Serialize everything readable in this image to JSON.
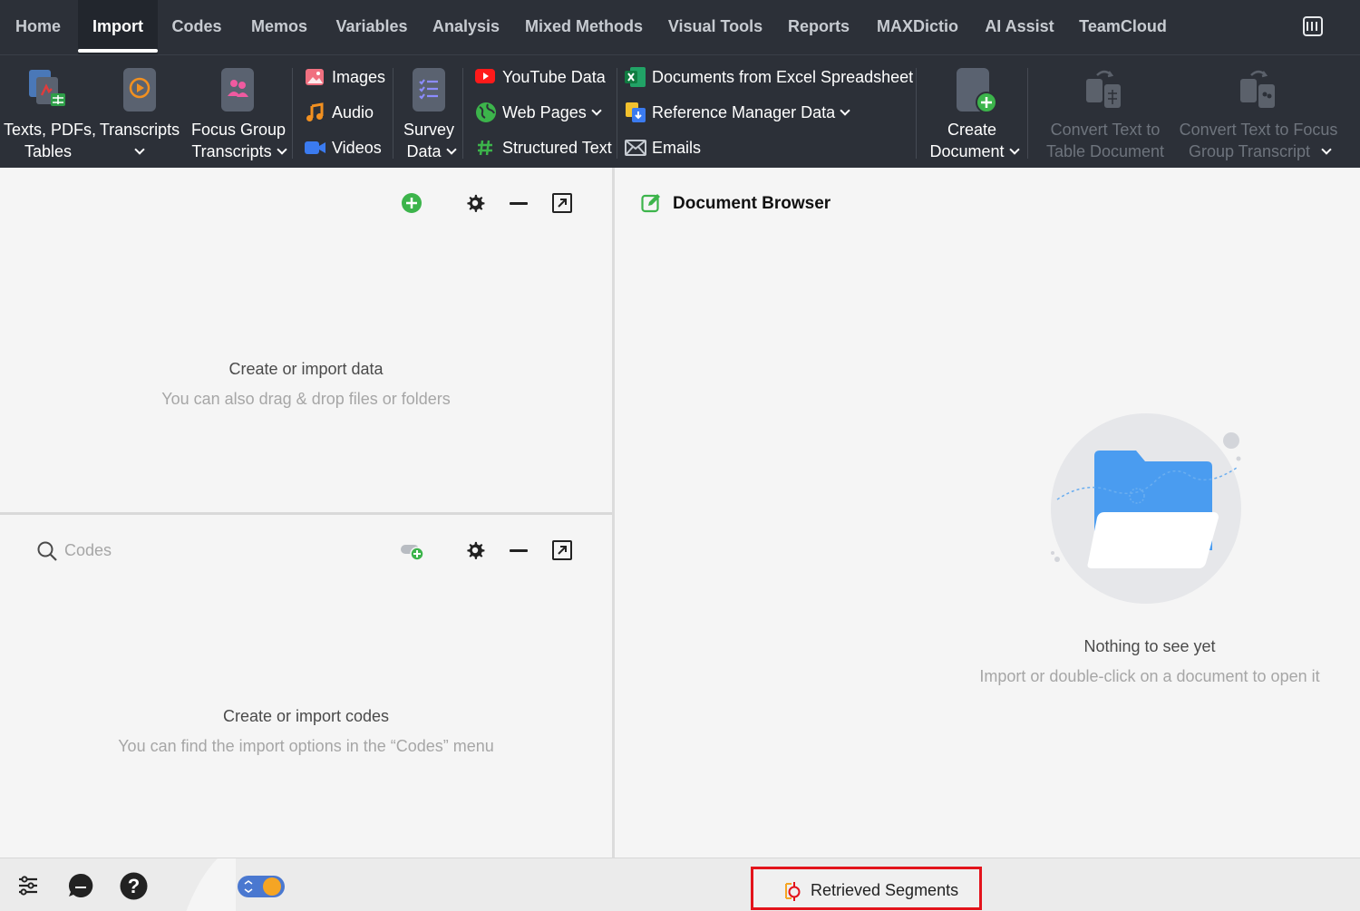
{
  "menubar": {
    "tabs": [
      {
        "label": "Home",
        "active": false
      },
      {
        "label": "Import",
        "active": true
      },
      {
        "label": "Codes",
        "active": false
      },
      {
        "label": "Memos",
        "active": false
      },
      {
        "label": "Variables",
        "active": false
      },
      {
        "label": "Analysis",
        "active": false
      },
      {
        "label": "Mixed Methods",
        "active": false
      },
      {
        "label": "Visual Tools",
        "active": false
      },
      {
        "label": "Reports",
        "active": false
      },
      {
        "label": "MAXDictio",
        "active": false
      },
      {
        "label": "AI Assist",
        "active": false
      },
      {
        "label": "TeamCloud",
        "active": false
      }
    ],
    "layout_icon": "columns-layout-icon"
  },
  "ribbon": {
    "texts": {
      "line1": "Texts, PDFs,",
      "line2": "Tables"
    },
    "transcripts": {
      "line1": "Transcripts"
    },
    "focus_group": {
      "line1": "Focus Group",
      "line2": "Transcripts"
    },
    "images": "Images",
    "audio": "Audio",
    "videos": "Videos",
    "survey": {
      "line1": "Survey",
      "line2": "Data"
    },
    "youtube": "YouTube Data",
    "web_pages": "Web Pages",
    "structured_text": "Structured Text",
    "excel_docs": "Documents from Excel Spreadsheet",
    "reference_manager": "Reference Manager Data",
    "emails": "Emails",
    "create_document": {
      "line1": "Create",
      "line2": "Document"
    },
    "convert_table": {
      "line1": "Convert Text to",
      "line2": "Table Document"
    },
    "convert_focus": {
      "line1": "Convert Text to Focus",
      "line2": "Group Transcript"
    }
  },
  "documents_pane": {
    "empty_title": "Create or import data",
    "empty_subtitle": "You can also drag & drop files or folders"
  },
  "codes_pane": {
    "search_placeholder": "Codes",
    "empty_title": "Create or import codes",
    "empty_subtitle": "You can find the import options in the “Codes” menu"
  },
  "document_browser": {
    "title": "Document Browser",
    "empty_title": "Nothing to see yet",
    "empty_subtitle": "Import or double-click on a document to open it"
  },
  "bottombar": {
    "retrieved_segments": "Retrieved Segments"
  },
  "colors": {
    "ribbon_bg": "#2c3038",
    "accent_green": "#3cb44b",
    "highlight_red": "#e3131b",
    "folder_blue": "#4a9cf0"
  }
}
